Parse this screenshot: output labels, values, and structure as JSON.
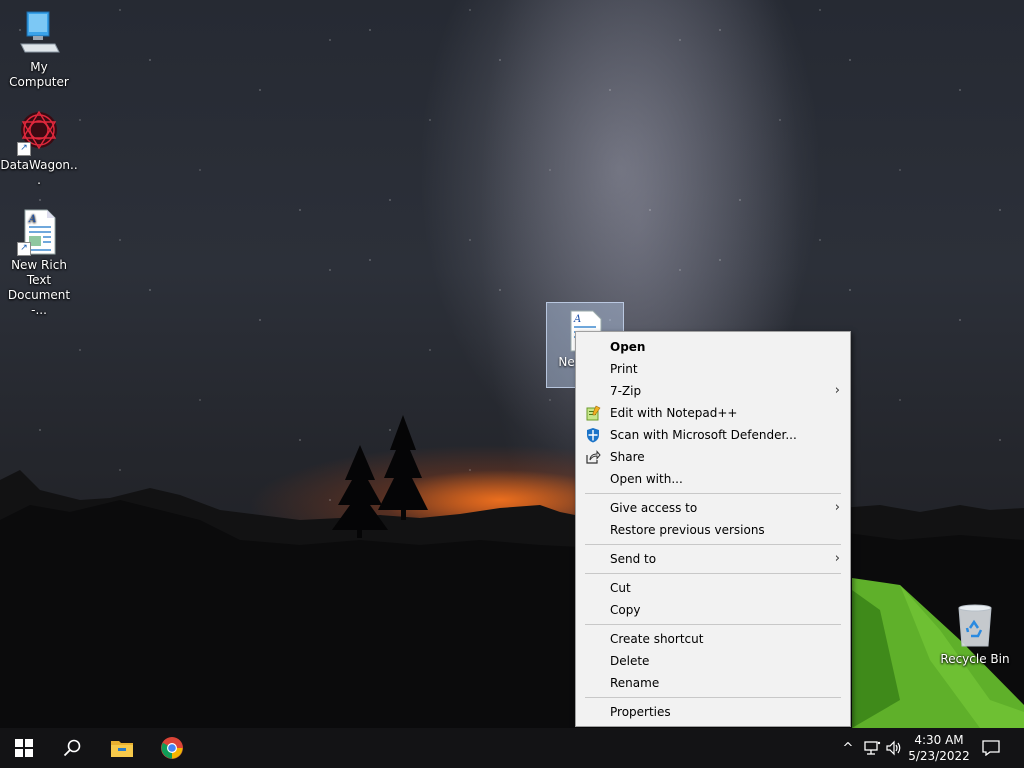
{
  "desktop": {
    "icons": [
      {
        "label": "My Computer",
        "icon": "computer-icon"
      },
      {
        "label": "DataWagon...",
        "icon": "datawagon-icon"
      },
      {
        "label": "New Rich Text Document -...",
        "icon": "rich-text-document-icon"
      },
      {
        "label": "Recycle Bin",
        "icon": "recycle-bin-icon"
      }
    ],
    "selected_icon": {
      "label": "New Doc",
      "icon": "rich-text-document-icon"
    }
  },
  "context_menu": {
    "items": [
      {
        "label": "Open",
        "bold": true
      },
      {
        "label": "Print"
      },
      {
        "label": "7-Zip",
        "submenu": true
      },
      {
        "label": "Edit with Notepad++",
        "icon": "notepad-plus-plus-icon"
      },
      {
        "label": "Scan with Microsoft Defender...",
        "icon": "defender-shield-icon"
      },
      {
        "label": "Share",
        "icon": "share-icon"
      },
      {
        "label": "Open with..."
      },
      {
        "label": "Give access to",
        "submenu": true
      },
      {
        "label": "Restore previous versions"
      },
      {
        "label": "Send to",
        "submenu": true
      },
      {
        "label": "Cut"
      },
      {
        "label": "Copy"
      },
      {
        "label": "Create shortcut"
      },
      {
        "label": "Delete"
      },
      {
        "label": "Rename"
      },
      {
        "label": "Properties"
      }
    ],
    "submenu_arrow": "›"
  },
  "taskbar": {
    "apps": [
      {
        "name": "start-button",
        "icon": "windows-logo-icon"
      },
      {
        "name": "search-button",
        "icon": "search-icon"
      },
      {
        "name": "file-explorer-button",
        "icon": "folder-icon"
      },
      {
        "name": "chrome-button",
        "icon": "chrome-icon"
      }
    ],
    "tray": {
      "chevron": "^",
      "time": "4:30 AM",
      "date": "5/23/2022"
    }
  },
  "colors": {
    "menu_bg": "#f2f2f2",
    "taskbar_bg": "#141416",
    "accent_blue": "#0078d7"
  }
}
